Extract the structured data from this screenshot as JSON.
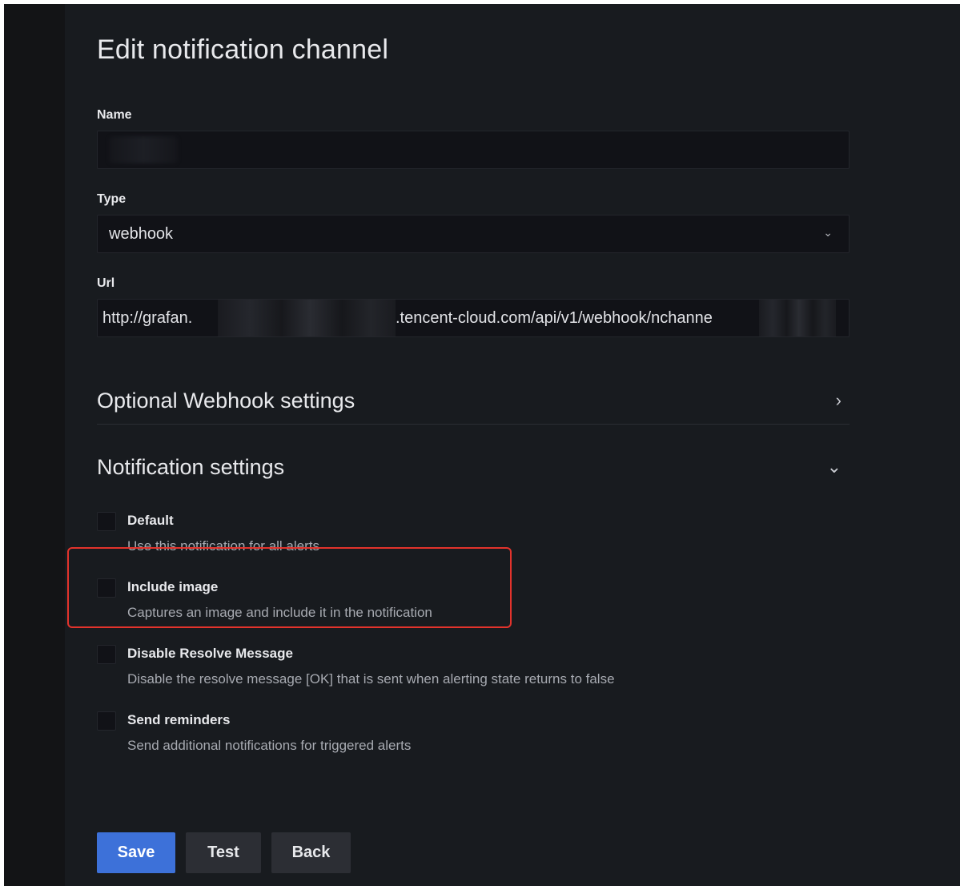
{
  "page": {
    "title": "Edit notification channel"
  },
  "fields": {
    "name": {
      "label": "Name",
      "value": ""
    },
    "type": {
      "label": "Type",
      "value": "webhook"
    },
    "url": {
      "label": "Url",
      "value_start": "http://grafan.",
      "value_end": ".tencent-cloud.com/api/v1/webhook/nchanne"
    }
  },
  "sections": {
    "optional_webhook": {
      "title": "Optional Webhook settings",
      "expanded": false
    },
    "notification": {
      "title": "Notification settings",
      "expanded": true
    }
  },
  "options": [
    {
      "title": "Default",
      "description": "Use this notification for all alerts",
      "checked": false
    },
    {
      "title": "Include image",
      "description": "Captures an image and include it in the notification",
      "checked": false
    },
    {
      "title": "Disable Resolve Message",
      "description": "Disable the resolve message [OK] that is sent when alerting state returns to false",
      "checked": false
    },
    {
      "title": "Send reminders",
      "description": "Send additional notifications for triggered alerts",
      "checked": false
    }
  ],
  "buttons": {
    "save": "Save",
    "test": "Test",
    "back": "Back"
  },
  "colors": {
    "background": "#181b1f",
    "primary_button": "#3d71d9",
    "highlight": "#e3332c"
  },
  "icons": {
    "select_chevron": "chevron-down-icon",
    "optional_section": "chevron-right-icon",
    "notification_section": "chevron-down-icon"
  }
}
